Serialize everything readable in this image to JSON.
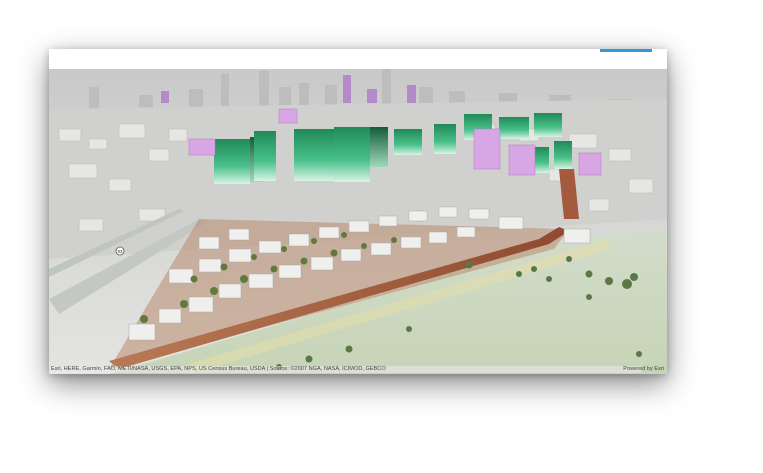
{
  "map": {
    "attribution": "Esri, HERE, Garmin, FAO, METI/NASA, USGS, EPA, NPS, US Census Bureau, USDA | Source: ©2007 NGA, NASA, ICIMOD, GEBCO",
    "attribution_right": "Powered by Esri",
    "route_shield": "93"
  },
  "colors": {
    "accent": "#2f9ad8",
    "proposed_tower_green": "#2aa86a",
    "existing_tower_purple": "#c98ad6",
    "street_corridor": "#a0553a",
    "park_grass": "#c8d6bb"
  },
  "icons": [
    "route-shield-icon"
  ]
}
